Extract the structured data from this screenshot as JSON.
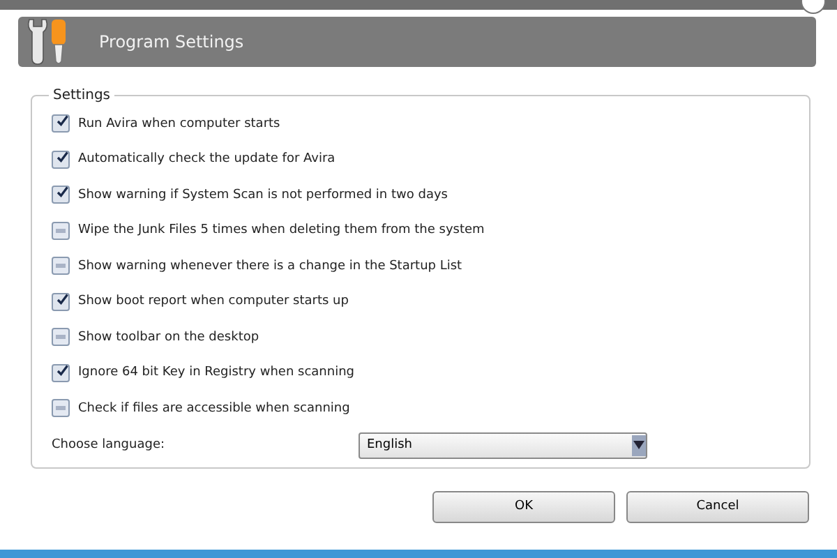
{
  "window": {
    "title": "Program Settings"
  },
  "group": {
    "title": "Settings"
  },
  "options": [
    {
      "label": "Run Avira when computer starts",
      "checked": true
    },
    {
      "label": "Automatically check the update for Avira",
      "checked": true
    },
    {
      "label": "Show warning if System Scan is not performed in two days",
      "checked": true
    },
    {
      "label": "Wipe the Junk Files 5 times when deleting them from the system",
      "checked": false
    },
    {
      "label": "Show warning whenever there is a change in the Startup List",
      "checked": false
    },
    {
      "label": "Show boot report when computer starts up",
      "checked": true
    },
    {
      "label": "Show toolbar on the desktop",
      "checked": false
    },
    {
      "label": "Ignore 64 bit Key in Registry when scanning",
      "checked": true
    },
    {
      "label": "Check if files are accessible when scanning",
      "checked": false
    }
  ],
  "language": {
    "label": "Choose language:",
    "value": "English"
  },
  "buttons": [
    "OK",
    "Cancel"
  ]
}
